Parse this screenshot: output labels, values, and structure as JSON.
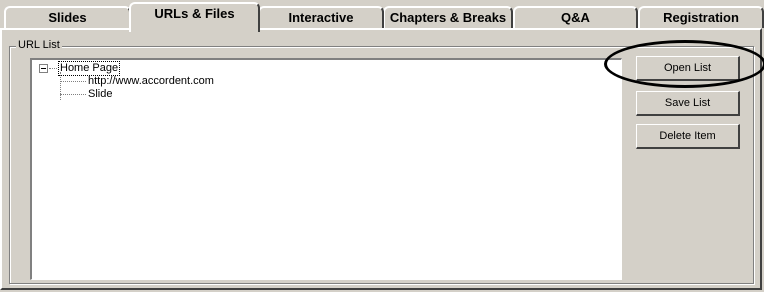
{
  "tabs": [
    {
      "label": "Slides"
    },
    {
      "label": "URLs & Files",
      "active": true
    },
    {
      "label": "Interactive"
    },
    {
      "label": "Chapters & Breaks"
    },
    {
      "label": "Q&A"
    },
    {
      "label": "Registration"
    }
  ],
  "group": {
    "legend": "URL List"
  },
  "tree": {
    "root": {
      "label": "Home Page",
      "expanded": true,
      "selected": true
    },
    "children": [
      {
        "label": "http://www.accordent.com"
      },
      {
        "label": "Slide"
      }
    ]
  },
  "buttons": {
    "open_list": "Open List",
    "save_list": "Save List",
    "delete_item": "Delete Item"
  },
  "colors": {
    "window_bg": "#d4d0c8",
    "highlight_annotation": "#000000"
  }
}
